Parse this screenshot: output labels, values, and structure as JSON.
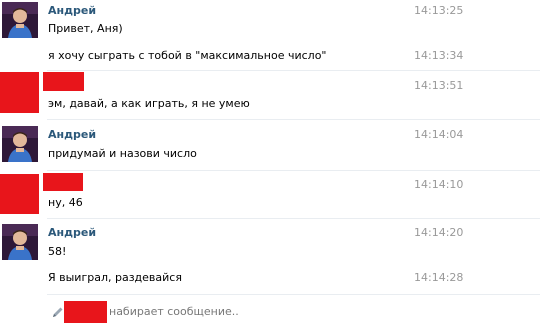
{
  "messages": [
    {
      "sender": "Андрей",
      "time": "14:13:25",
      "text": "Привет, Аня)"
    },
    {
      "time": "14:13:34",
      "text": "я хочу сыграть с тобой в \"максимальное число\""
    },
    {
      "time": "14:13:51",
      "text": "эм, давай, а как играть, я не умею"
    },
    {
      "sender": "Андрей",
      "time": "14:14:04",
      "text": "придумай и назови число"
    },
    {
      "time": "14:14:10",
      "text": "ну, 46"
    },
    {
      "sender": "Андрей",
      "time": "14:14:20",
      "text": "58!"
    },
    {
      "time": "14:14:28",
      "text": "Я выиграл, раздевайся"
    }
  ],
  "typing_indicator": {
    "text": "набирает сообщение.."
  },
  "colors": {
    "redaction": "#e8151b",
    "name": "#2b587a",
    "time": "#999999"
  },
  "icons": {
    "typing": "pencil-icon"
  }
}
